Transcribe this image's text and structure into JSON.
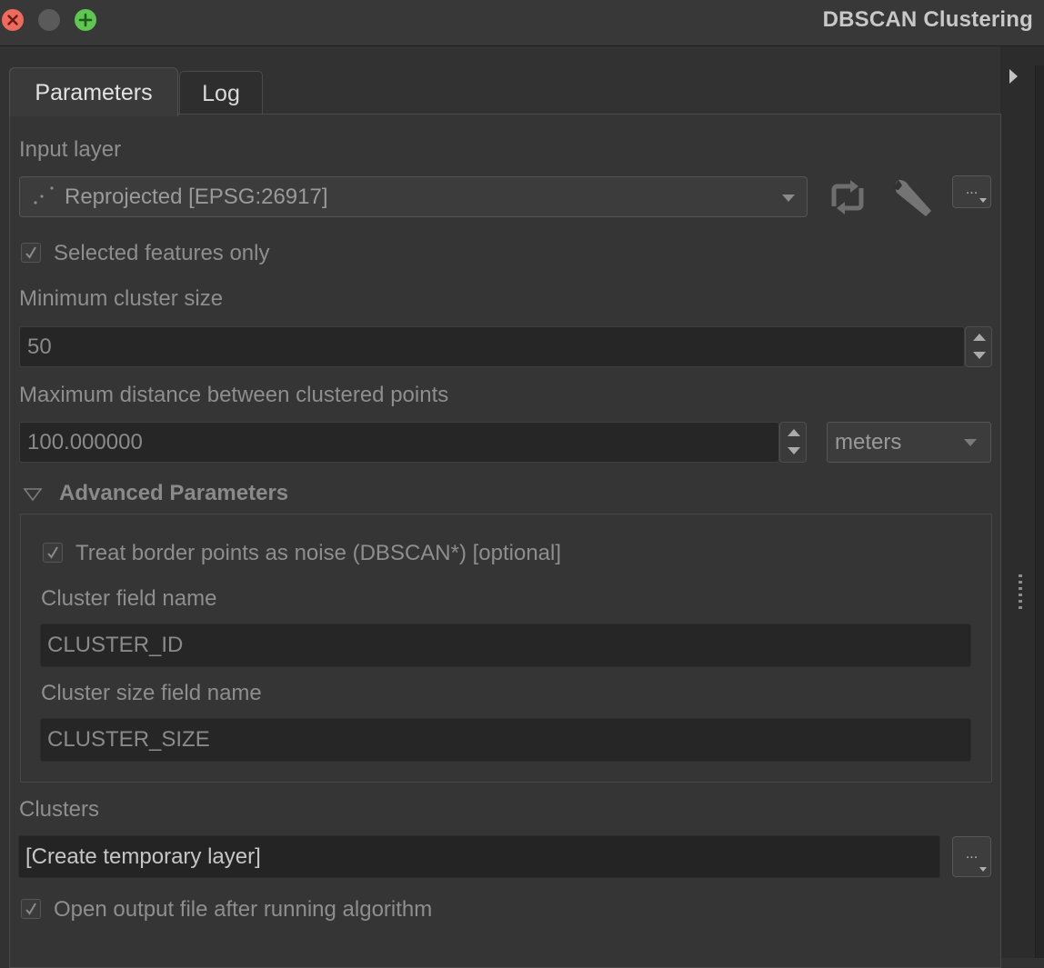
{
  "window": {
    "title": "DBSCAN Clustering"
  },
  "tabs": [
    {
      "label": "Parameters"
    },
    {
      "label": "Log"
    }
  ],
  "form": {
    "input_layer": {
      "label": "Input layer",
      "value": "Reprojected [EPSG:26917]",
      "more_button": "..."
    },
    "selected_only": {
      "label": "Selected features only",
      "checked": true
    },
    "min_cluster_size": {
      "label": "Minimum cluster size",
      "value": "50"
    },
    "max_distance": {
      "label": "Maximum distance between clustered points",
      "value": "100.000000",
      "unit": "meters"
    },
    "advanced": {
      "title": "Advanced Parameters",
      "border_noise": {
        "label": "Treat border points as noise (DBSCAN*) [optional]",
        "checked": true
      },
      "cluster_field": {
        "label": "Cluster field name",
        "value": "CLUSTER_ID"
      },
      "cluster_size_field": {
        "label": "Cluster size field name",
        "value": "CLUSTER_SIZE"
      }
    },
    "clusters": {
      "label": "Clusters",
      "value": "[Create temporary layer]",
      "more_button": "..."
    },
    "open_output": {
      "label": "Open output file after running algorithm",
      "checked": true
    }
  },
  "colors": {
    "background": "#323232",
    "close": "#ed6a5e",
    "maximize": "#61c554"
  }
}
